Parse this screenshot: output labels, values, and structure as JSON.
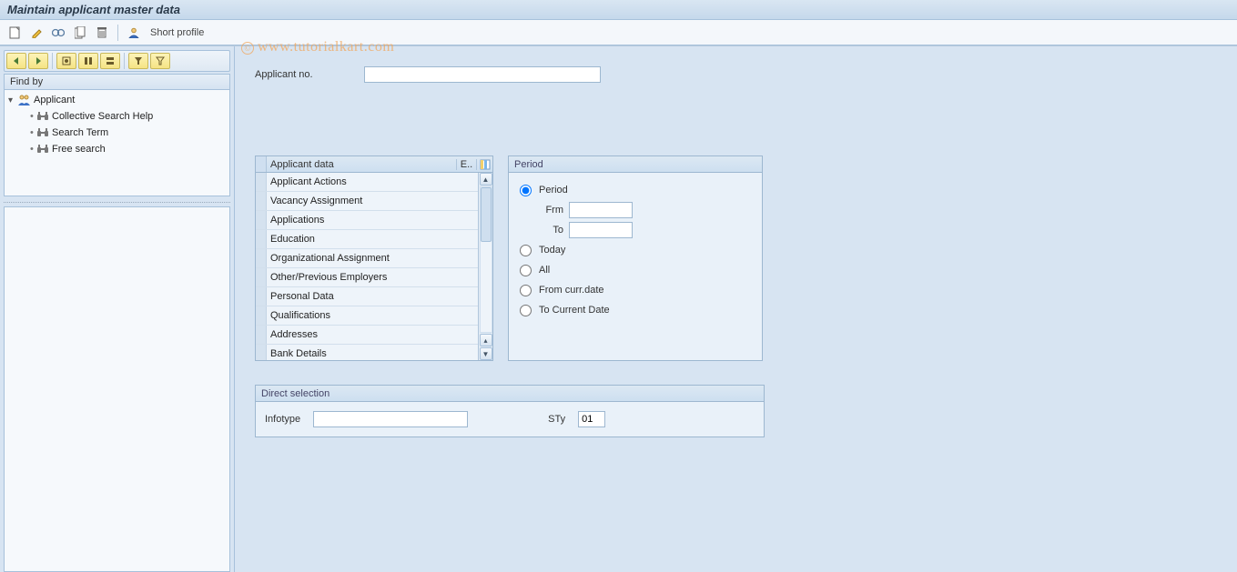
{
  "title": "Maintain applicant master data",
  "toolbar": {
    "short_profile_label": "Short profile"
  },
  "watermark": "www.tutorialkart.com",
  "sidebar": {
    "findby_label": "Find by",
    "root": "Applicant",
    "children": [
      "Collective Search Help",
      "Search Term",
      "Free search"
    ]
  },
  "applicant_no": {
    "label": "Applicant no.",
    "value": ""
  },
  "listbox": {
    "header": "Applicant data",
    "col_e": "E..",
    "rows": [
      "Applicant Actions",
      "Vacancy Assignment",
      "Applications",
      "Education",
      "Organizational Assignment",
      "Other/Previous Employers",
      "Personal Data",
      "Qualifications",
      "Addresses",
      "Bank Details"
    ]
  },
  "period": {
    "title": "Period",
    "options": {
      "period": "Period",
      "frm_label": "Frm",
      "frm_value": "",
      "to_label": "To",
      "to_value": "",
      "today": "Today",
      "all": "All",
      "from_curr": "From curr.date",
      "to_current": "To Current Date"
    }
  },
  "direct": {
    "title": "Direct selection",
    "infotype_label": "Infotype",
    "infotype_value": "",
    "sty_label": "STy",
    "sty_value": "01"
  }
}
